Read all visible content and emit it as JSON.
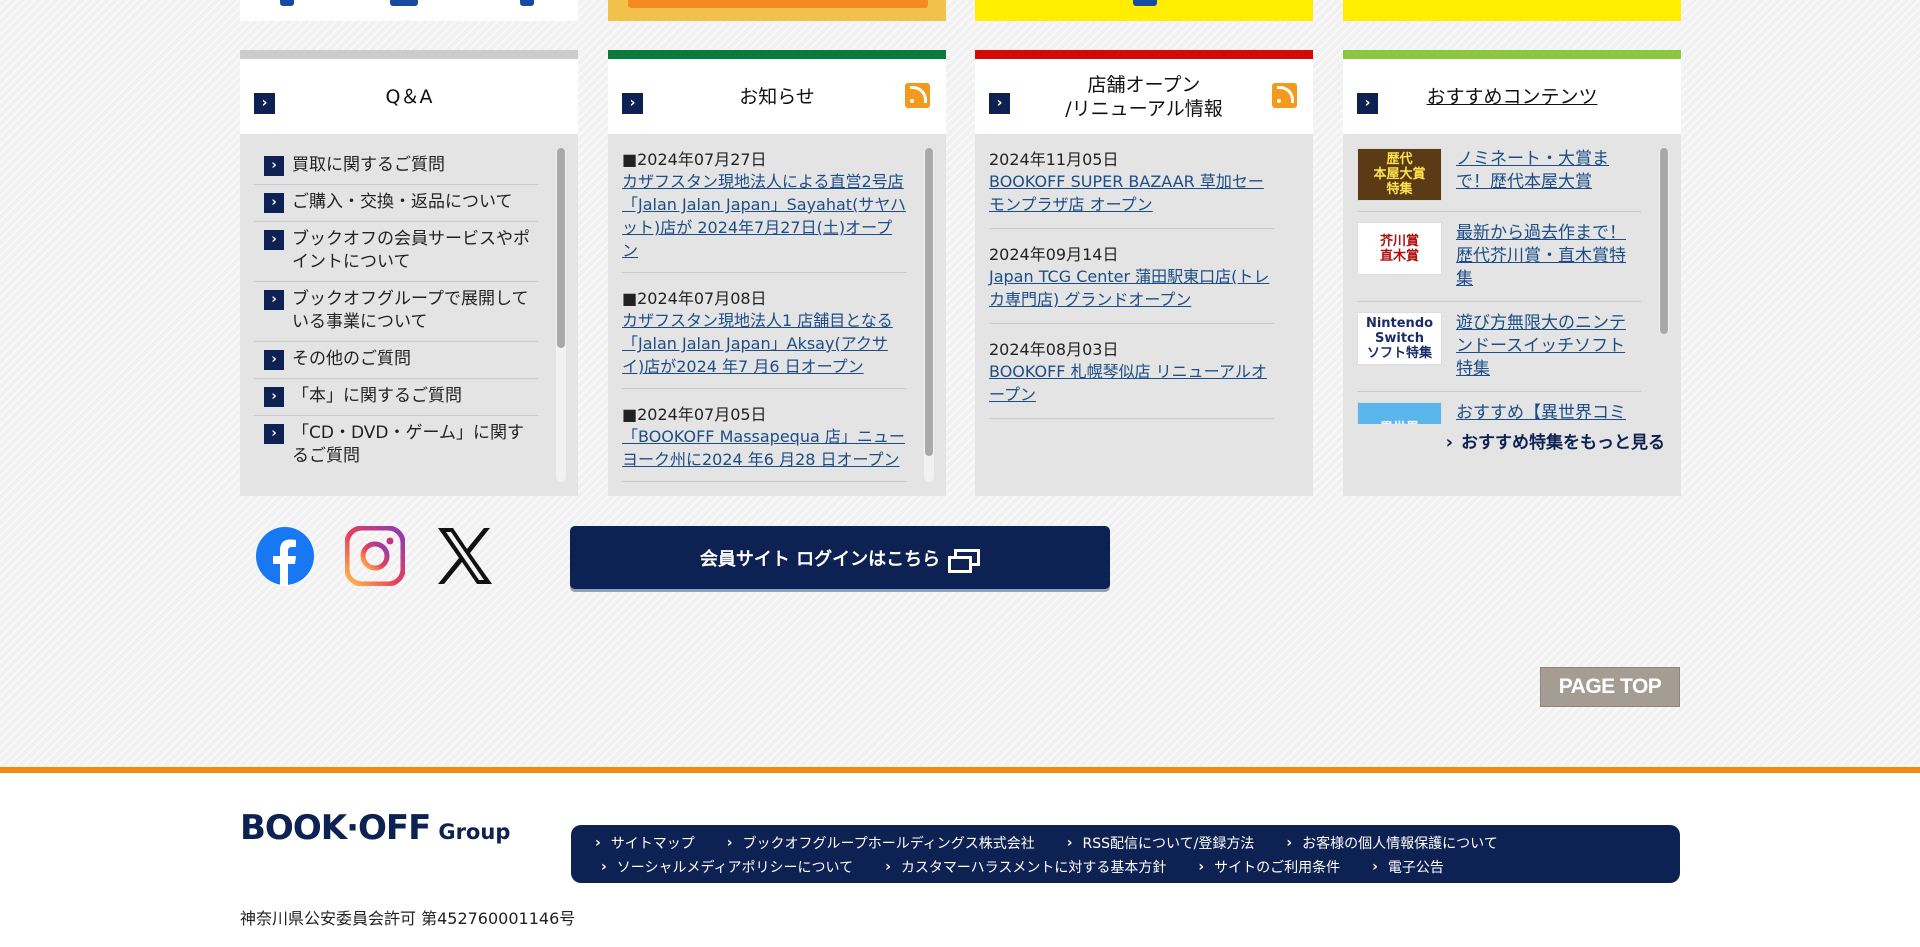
{
  "qa": {
    "title": "Q＆A",
    "accent_color": "#cccccc",
    "items": [
      "買取に関するご質問",
      "ご購入・交換・返品について",
      "ブックオフの会員サービスやポイントについて",
      "ブックオフグループで展開している事業について",
      "その他のご質問",
      "「本」に関するご質問",
      "「CD・DVD・ゲーム」に関するご質問"
    ]
  },
  "news": {
    "title": "お知らせ",
    "accent_color": "#0a7a3c",
    "items": [
      {
        "date": "■2024年07月27日",
        "text": "カザフスタン現地法人による直営2号店「Jalan Jalan Japan」Sayahat(サヤハット)店が 2024年7月27日(土)オープン"
      },
      {
        "date": "■2024年07月08日",
        "text": "カザフスタン現地法人1 店舗目となる「Jalan Jalan Japan」Aksay(アクサイ)店が2024 年7 月6 日オープン"
      },
      {
        "date": "■2024年07月05日",
        "text": "「BOOKOFF Massapequa 店」ニューヨーク州に2024 年6 月28 日オープン"
      }
    ]
  },
  "shops": {
    "title_line1": "店舗オープン",
    "title_line2": "/リニューアル情報",
    "accent_color": "#d20a0a",
    "items": [
      {
        "date": "2024年11月05日",
        "text": "BOOKOFF SUPER BAZAAR 草加セーモンプラザ店 オープン"
      },
      {
        "date": "2024年09月14日",
        "text": "Japan TCG Center 蒲田駅東口店(トレカ専門店) グランドオープン"
      },
      {
        "date": "2024年08月03日",
        "text": "BOOKOFF 札幌琴似店 リニューアルオープン"
      }
    ]
  },
  "recommend": {
    "title": "おすすめコンテンツ",
    "accent_color": "#8dc63f",
    "items": [
      {
        "thumb": "歴代\n本屋大賞\n特集",
        "text": "ノミネート・大賞まで！歴代本屋大賞"
      },
      {
        "thumb": "芥川賞\n直木賞",
        "text": "最新から過去作まで！歴代芥川賞・直木賞特集"
      },
      {
        "thumb": "Nintendo\nSwitch\nソフト特集",
        "text": "遊び方無限大のニンテンドースイッチソフト特集"
      },
      {
        "thumb": "異世界",
        "text": "おすすめ【異世界コミック特集】転生・召喚漫画"
      }
    ],
    "more_label": "おすすめ特集をもっと見る"
  },
  "social": {
    "facebook": "facebook-icon",
    "instagram": "instagram-icon",
    "x": "x-icon"
  },
  "login_label": "会員サイト ログインはこちら",
  "pagetop_label": "PAGE TOP",
  "footer": {
    "logo_text": "BOOK·OFF",
    "logo_group": "Group",
    "nav_row1": [
      "サイトマップ",
      "ブックオフグループホールディングス株式会社",
      "RSS配信について/登録方法",
      "お客様の個人情報保護について"
    ],
    "nav_row2": [
      "ソーシャルメディアポリシーについて",
      "カスタマーハラスメントに対する基本方針",
      "サイトのご利用条件",
      "電子公告"
    ],
    "license": "神奈川県公安委員会許可 第452760001146号"
  }
}
